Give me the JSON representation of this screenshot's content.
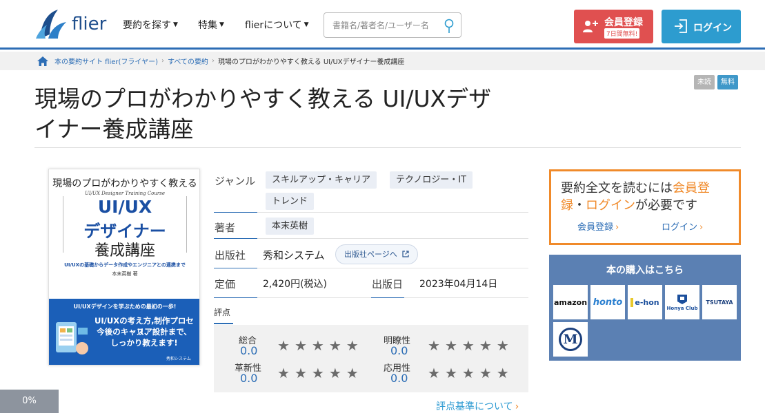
{
  "header": {
    "logo_text": "flier",
    "nav": [
      {
        "label": "要約を探す"
      },
      {
        "label": "特集"
      },
      {
        "label": "flierについて"
      }
    ],
    "search_placeholder": "書籍名/著者名/ユーザー名",
    "register_label": "会員登録",
    "register_sub": "7日間無料!",
    "login_label": "ログイン"
  },
  "breadcrumb": {
    "home": "本の要約サイト flier(フライヤー)",
    "all": "すべての要約",
    "current": "現場のプロがわかりやすく教える UI/UXデザイナー養成講座"
  },
  "badges": {
    "unread": "未読",
    "free": "無料"
  },
  "book": {
    "title_line1": "現場のプロがわかりやすく教える UI/UXデザ",
    "title_line2": "イナー養成講座",
    "cover": {
      "top": "現場のプロがわかりやすく教える",
      "subtitle_en": "UI/UX Designer Training Course",
      "main1": "UI/UX",
      "main2": "デザイナー",
      "main3": "養成講座",
      "lead": "UI/UXの基礎からデータ作成やエンジニアとの連携まで",
      "author": "本末英樹 著",
      "band_top": "UI/UXデザインを学ぶための最初の一歩!",
      "band1": "UI/UXの考え方,制作プロセス、",
      "band2": "今後のキャリア設計まで、",
      "band3": "しっかり教えます!",
      "publisher_mark": "秀和システム"
    },
    "genre_label": "ジャンル",
    "genres": [
      "スキルアップ・キャリア",
      "テクノロジー・IT",
      "トレンド"
    ],
    "author_label": "著者",
    "author": "本末英樹",
    "publisher_label": "出版社",
    "publisher": "秀和システム",
    "publisher_link": "出版社ページへ",
    "price_label": "定価",
    "price": "2,420円(税込)",
    "date_label": "出版日",
    "date": "2023年04月14日"
  },
  "ratings": {
    "tab": "評点",
    "items": [
      {
        "label": "総合",
        "value": "0.0"
      },
      {
        "label": "明瞭性",
        "value": "0.0"
      },
      {
        "label": "革新性",
        "value": "0.0"
      },
      {
        "label": "応用性",
        "value": "0.0"
      }
    ],
    "link": "評点基準について"
  },
  "prompt": {
    "pre": "要約全文を読むには",
    "reg": "会員登録",
    "dot": "・",
    "login": "ログイン",
    "post": "が必要です",
    "link_register": "会員登録",
    "link_login": "ログイン"
  },
  "purchase": {
    "title": "本の購入はこちら",
    "stores": [
      "amazon",
      "honto",
      "e-hon",
      "Honya Club",
      "TSUTAYA",
      "M"
    ]
  },
  "progress": "0%",
  "colors": {
    "brand": "#2c6db5",
    "register": "#e05050",
    "login": "#2d9ccf",
    "accent": "#f08a2a"
  }
}
